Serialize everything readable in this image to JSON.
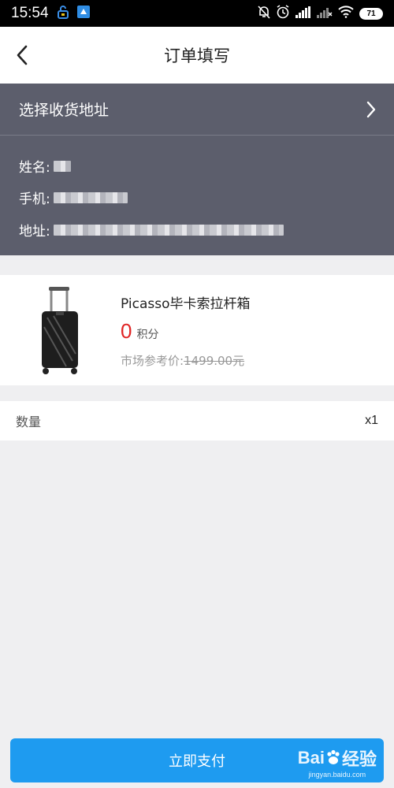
{
  "status_bar": {
    "time": "15:54",
    "battery": "71"
  },
  "nav": {
    "title": "订单填写"
  },
  "address": {
    "select_label": "选择收货地址",
    "name_label": "姓名:",
    "phone_label": "手机:",
    "addr_label": "地址:"
  },
  "product": {
    "name": "Picasso毕卡索拉杆箱",
    "price": "0",
    "price_unit": "积分",
    "market_label": "市场参考价:",
    "market_price": "1499.00元"
  },
  "quantity": {
    "label": "数量",
    "value": "x1"
  },
  "pay": {
    "label": "立即支付"
  },
  "watermark": {
    "logo_left": "Bai",
    "logo_right": "经验",
    "sub": "jingyan.baidu.com"
  },
  "colors": {
    "accent": "#1e9bf0",
    "price": "#e02424",
    "address_bg": "#5c5e6c"
  }
}
